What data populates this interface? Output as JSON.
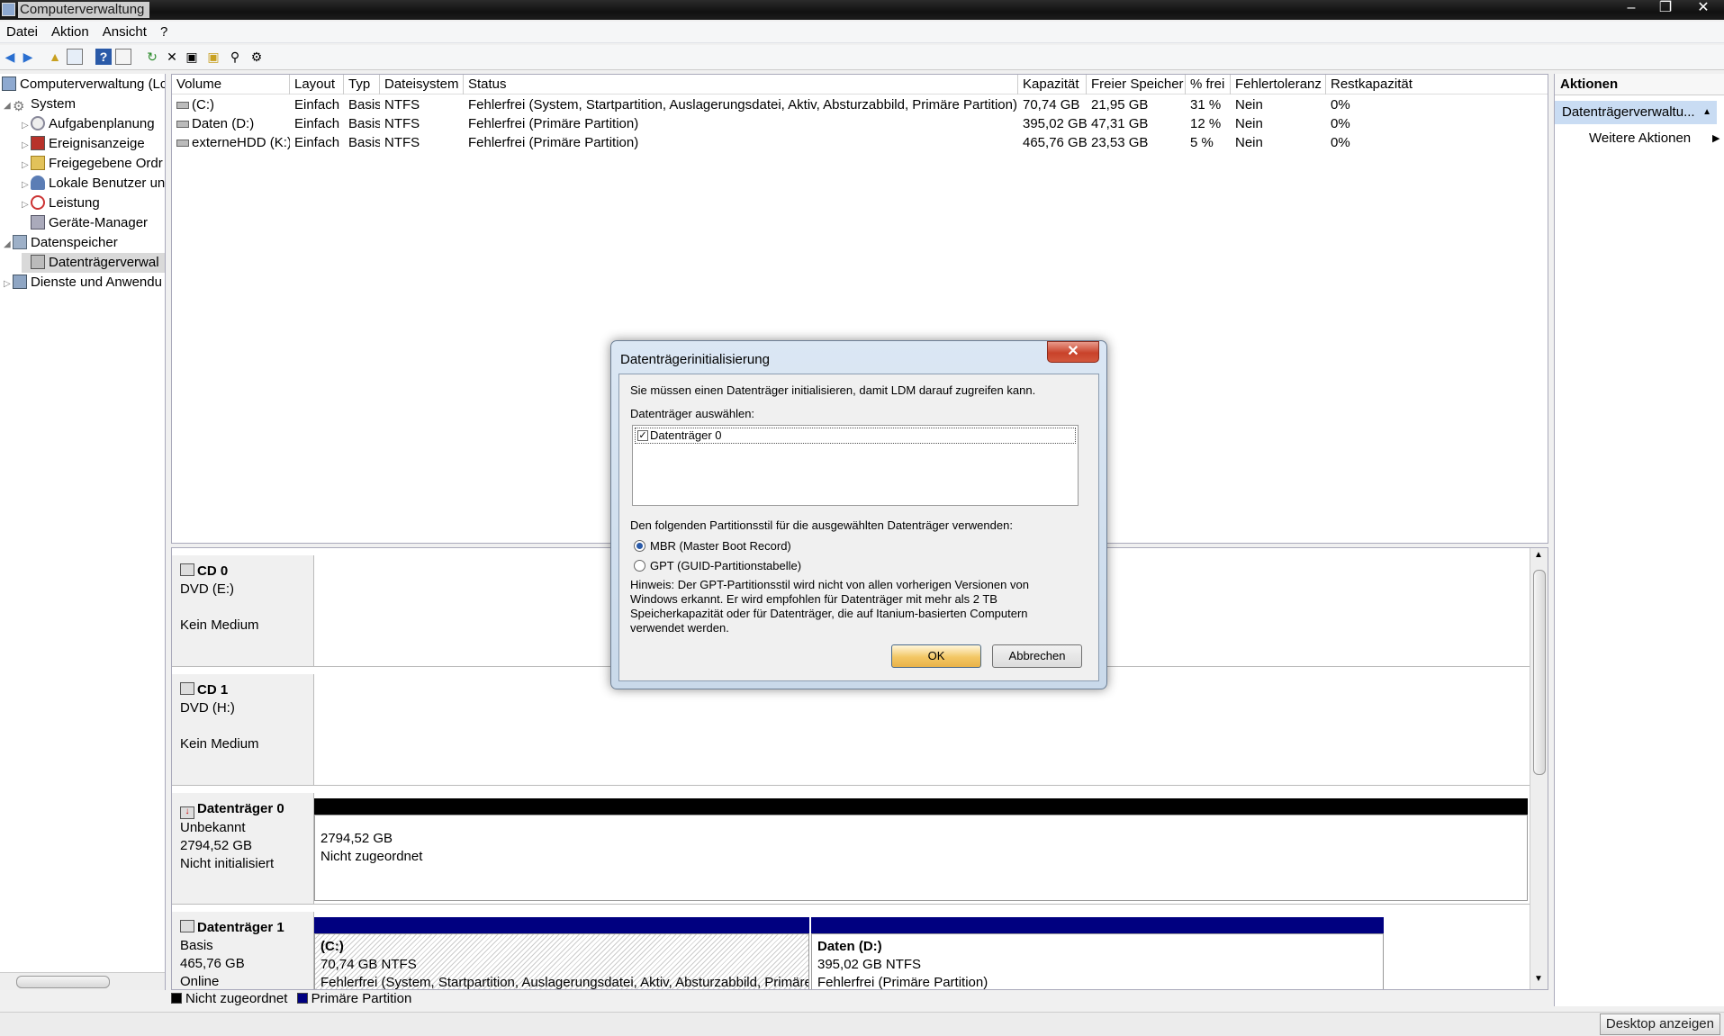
{
  "window": {
    "title": "Computerverwaltung"
  },
  "menu": {
    "items": [
      "Datei",
      "Aktion",
      "Ansicht",
      "?"
    ]
  },
  "tree": {
    "root": "Computerverwaltung (Lc",
    "items": [
      {
        "label": "System",
        "level": 1,
        "icon": "system-icon"
      },
      {
        "label": "Aufgabenplanung",
        "level": 2,
        "icon": "clock-icon"
      },
      {
        "label": "Ereignisanzeige",
        "level": 2,
        "icon": "event-icon"
      },
      {
        "label": "Freigegebene Ordr",
        "level": 2,
        "icon": "shared-folder-icon"
      },
      {
        "label": "Lokale Benutzer un",
        "level": 2,
        "icon": "users-icon"
      },
      {
        "label": "Leistung",
        "level": 2,
        "icon": "performance-icon"
      },
      {
        "label": "Geräte-Manager",
        "level": 2,
        "icon": "device-manager-icon"
      },
      {
        "label": "Datenspeicher",
        "level": 1,
        "icon": "storage-icon"
      },
      {
        "label": "Datenträgerverwal",
        "level": 2,
        "icon": "disk-management-icon"
      },
      {
        "label": "Dienste und Anwendu",
        "level": 1,
        "icon": "services-icon"
      }
    ]
  },
  "volumes": {
    "columns": [
      "Volume",
      "Layout",
      "Typ",
      "Dateisystem",
      "Status",
      "Kapazität",
      "Freier Speicher",
      "% frei",
      "Fehlertoleranz",
      "Restkapazität"
    ],
    "rows": [
      [
        "(C:)",
        "Einfach",
        "Basis",
        "NTFS",
        "Fehlerfrei (System, Startpartition, Auslagerungsdatei, Aktiv, Absturzabbild, Primäre Partition)",
        "70,74 GB",
        "21,95 GB",
        "31 %",
        "Nein",
        "0%"
      ],
      [
        "Daten (D:)",
        "Einfach",
        "Basis",
        "NTFS",
        "Fehlerfrei (Primäre Partition)",
        "395,02 GB",
        "47,31 GB",
        "12 %",
        "Nein",
        "0%"
      ],
      [
        "externeHDD (K:)",
        "Einfach",
        "Basis",
        "NTFS",
        "Fehlerfrei (Primäre Partition)",
        "465,76 GB",
        "23,53 GB",
        "5 %",
        "Nein",
        "0%"
      ]
    ]
  },
  "disks": {
    "cd0": {
      "name": "CD 0",
      "type": "DVD (E:)",
      "state": "Kein Medium"
    },
    "cd1": {
      "name": "CD 1",
      "type": "DVD (H:)",
      "state": "Kein Medium"
    },
    "disk0": {
      "name": "Datenträger 0",
      "type": "Unbekannt",
      "size": "2794,52 GB",
      "state": "Nicht initialisiert",
      "partition": {
        "size": "2794,52 GB",
        "label": "Nicht zugeordnet"
      }
    },
    "disk1": {
      "name": "Datenträger 1",
      "type": "Basis",
      "size": "465,76 GB",
      "state": "Online",
      "partitions": [
        {
          "title": "(C:)",
          "size": "70,74 GB NTFS",
          "status": "Fehlerfrei (System, Startpartition, Auslagerungsdatei, Aktiv, Absturzabbild, Primäre"
        },
        {
          "title": "Daten  (D:)",
          "size": "395,02 GB NTFS",
          "status": "Fehlerfrei (Primäre Partition)"
        }
      ]
    }
  },
  "legend": {
    "unallocated": "Nicht zugeordnet",
    "primary": "Primäre Partition"
  },
  "actions": {
    "header": "Aktionen",
    "selected": "Datenträgerverwaltu...",
    "more": "Weitere Aktionen"
  },
  "statusbar": {
    "desktop_button": "Desktop anzeigen"
  },
  "dialog": {
    "title": "Datenträgerinitialisierung",
    "intro": "Sie müssen einen Datenträger initialisieren, damit LDM darauf zugreifen kann.",
    "select_label": "Datenträger auswählen:",
    "disk_item": "Datenträger 0",
    "style_label": "Den folgenden Partitionsstil für die ausgewählten Datenträger verwenden:",
    "mbr": "MBR (Master Boot Record)",
    "gpt": "GPT (GUID-Partitionstabelle)",
    "hint": [
      "Hinweis: Der GPT-Partitionsstil wird nicht von allen vorherigen Versionen von",
      "Windows erkannt. Er wird empfohlen für Datenträger mit mehr als 2 TB",
      "Speicherkapazität oder für Datenträger, die auf Itanium-basierten Computern",
      "verwendet werden."
    ],
    "ok": "OK",
    "cancel": "Abbrechen"
  },
  "colors": {
    "primary_partition": "#000080",
    "unallocated": "#000000",
    "selection": "#c9dcf3"
  }
}
